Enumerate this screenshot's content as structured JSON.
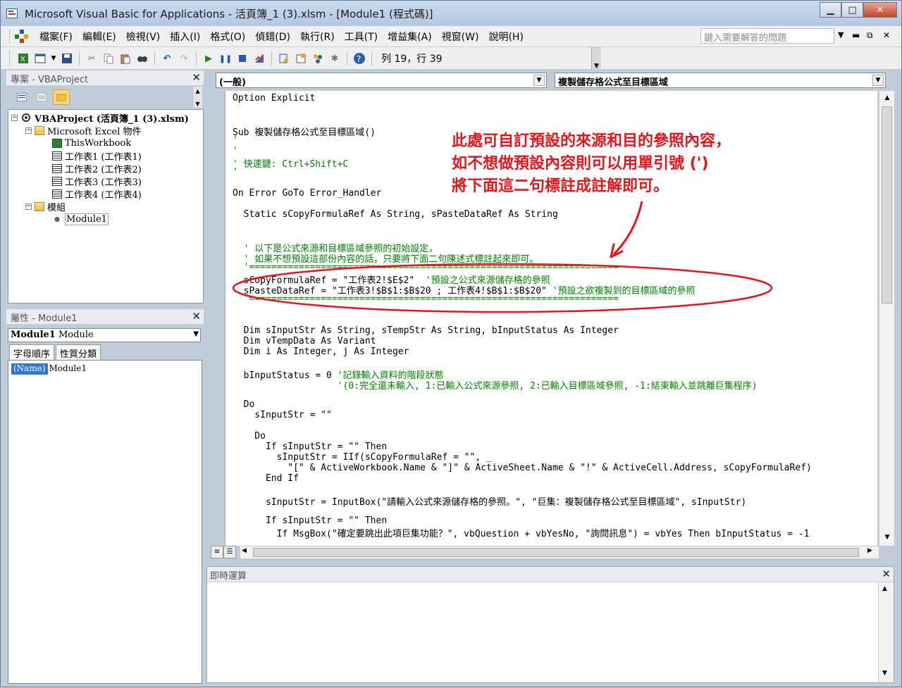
{
  "window": {
    "title": "Microsoft Visual Basic for Applications - 活頁簿_1 (3).xlsm - [Module1 (程式碼)]",
    "minimize": "▁",
    "maximize": "□",
    "close": "✕"
  },
  "menu": {
    "items": [
      "檔案(F)",
      "編輯(E)",
      "檢視(V)",
      "插入(I)",
      "格式(O)",
      "偵錯(D)",
      "執行(R)",
      "工具(T)",
      "增益集(A)",
      "視窗(W)",
      "說明(H)"
    ],
    "help_placeholder": "鍵入需要解答的問題"
  },
  "toolbar": {
    "position": "列 19，行 39"
  },
  "project_panel": {
    "title": "專案 - VBAProject",
    "tree": {
      "root": "VBAProject (活頁簿_1 (3).xlsm)",
      "excel_objects": "Microsoft Excel 物件",
      "this_workbook": "ThisWorkbook",
      "sheets": [
        "工作表1 (工作表1)",
        "工作表2 (工作表2)",
        "工作表3 (工作表3)",
        "工作表4 (工作表4)"
      ],
      "modules_folder": "模組",
      "module1": "Module1"
    }
  },
  "properties_panel": {
    "title": "屬性 - Module1",
    "object_name": "Module1",
    "object_type": "Module",
    "tabs": [
      "字母順序",
      "性質分類"
    ],
    "row_key": "(Name)",
    "row_value": "Module1"
  },
  "code_window": {
    "object_combo": "(一般)",
    "proc_combo": "複製儲存格公式至目標區域",
    "lines": [
      {
        "text": "Option Explicit",
        "comment": ""
      },
      {
        "text": "",
        "comment": ""
      },
      {
        "text": "",
        "comment": ""
      },
      {
        "text": "Sub 複製儲存格公式至目標區域()",
        "comment": ""
      },
      {
        "text": "",
        "comment": "'"
      },
      {
        "text": "",
        "comment": "'"
      },
      {
        "text": "",
        "comment": "' 快速鍵: Ctrl+Shift+C"
      },
      {
        "text": "",
        "comment": "'"
      },
      {
        "text": "",
        "comment": ""
      },
      {
        "text": "On Error GoTo Error_Handler",
        "comment": ""
      },
      {
        "text": "",
        "comment": ""
      },
      {
        "text": "  Static sCopyFormulaRef As String, sPasteDataRef As String",
        "comment": ""
      },
      {
        "text": "",
        "comment": ""
      },
      {
        "text": "",
        "comment": ""
      },
      {
        "text": "  ",
        "comment": "' 以下是公式來源和目標區域參照的初始設定，"
      },
      {
        "text": "  ",
        "comment": "' 如果不想預設這部份內容的話，只要將下面二句陳述式標註起來即可。"
      },
      {
        "text": "  ",
        "comment": "'==================================================================="
      },
      {
        "text": "  sCopyFormulaRef = \"工作表2!$E$2\"  ",
        "comment": "'預設之公式來源儲存格的參照"
      },
      {
        "text": "  sPasteDataRef = \"工作表3!$B$1:$B$20 ; 工作表4!$B$1:$B$20\" ",
        "comment": "'預設之欲複製到的目標區域的參照"
      },
      {
        "text": "  ",
        "comment": "'==================================================================="
      },
      {
        "text": "",
        "comment": ""
      },
      {
        "text": "",
        "comment": ""
      },
      {
        "text": "  Dim sInputStr As String, sTempStr As String, bInputStatus As Integer",
        "comment": ""
      },
      {
        "text": "  Dim vTempData As Variant",
        "comment": ""
      },
      {
        "text": "  Dim i As Integer, j As Integer",
        "comment": ""
      },
      {
        "text": "",
        "comment": ""
      },
      {
        "text": "  bInputStatus = 0 ",
        "comment": "'記錄輸入資料的階段狀態"
      },
      {
        "text": "                   ",
        "comment": "'(0:完全還未輸入, 1:已輸入公式來源參照, 2:已輸入目標區域參照, -1:結束輸入並跳離巨集程序)"
      },
      {
        "text": "",
        "comment": ""
      },
      {
        "text": "  Do",
        "comment": ""
      },
      {
        "text": "    sInputStr = \"\"",
        "comment": ""
      },
      {
        "text": "",
        "comment": ""
      },
      {
        "text": "    Do",
        "comment": ""
      },
      {
        "text": "      If sInputStr = \"\" Then",
        "comment": ""
      },
      {
        "text": "        sInputStr = IIf(sCopyFormulaRef = \"\", _",
        "comment": ""
      },
      {
        "text": "          \"[\" & ActiveWorkbook.Name & \"]\" & ActiveSheet.Name & \"!\" & ActiveCell.Address, sCopyFormulaRef)",
        "comment": ""
      },
      {
        "text": "      End If",
        "comment": ""
      },
      {
        "text": "",
        "comment": ""
      },
      {
        "text": "      sInputStr = InputBox(\"請輸入公式來源儲存格的參照。\", \"巨集：複製儲存格公式至目標區域\", sInputStr)",
        "comment": ""
      },
      {
        "text": "",
        "comment": ""
      },
      {
        "text": "      If sInputStr = \"\" Then",
        "comment": ""
      },
      {
        "text": "        If MsgBox(\"確定要跳出此項巨集功能？\", vbQuestion + vbYesNo, \"詢問訊息\") = vbYes Then bInputStatus = -1",
        "comment": ""
      }
    ]
  },
  "immediate_panel": {
    "title": "即時運算"
  },
  "annotation": {
    "lines": [
      "此處可自訂預設的來源和目的參照內容，",
      "如不想做預設內容則可以用單引號 (')",
      "將下面這二句標註成註解即可。"
    ],
    "color": "#e4151c"
  }
}
